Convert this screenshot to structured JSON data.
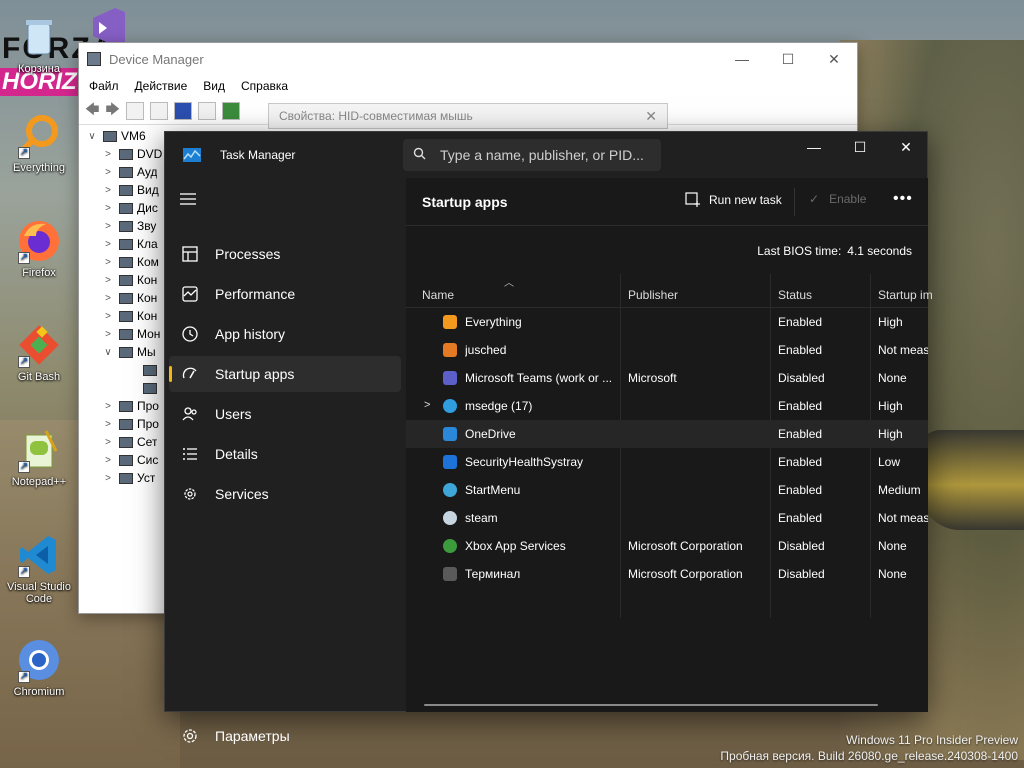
{
  "desktop": {
    "wallpaper_logo": {
      "line1": "FORZA",
      "line2": "HORIZ"
    },
    "icons": [
      {
        "name": "recycle-bin",
        "label": "Корзина"
      },
      {
        "name": "visual-studio",
        "label": ""
      },
      {
        "name": "everything",
        "label": "Everything"
      },
      {
        "name": "firefox",
        "label": "Firefox"
      },
      {
        "name": "git-bash",
        "label": "Git Bash"
      },
      {
        "name": "notepad-plus-plus",
        "label": "Notepad++"
      },
      {
        "name": "vscode",
        "label": "Visual Studio Code"
      },
      {
        "name": "chromium",
        "label": "Chromium"
      }
    ],
    "watermark": {
      "line1": "Windows 11 Pro Insider Preview",
      "line2": "Пробная версия. Build 26080.ge_release.240308-1400"
    }
  },
  "device_manager": {
    "title": "Device Manager",
    "menu": [
      "Файл",
      "Действие",
      "Вид",
      "Справка"
    ],
    "tree": [
      {
        "chev": "∨",
        "label": "VM6"
      },
      {
        "chev": ">",
        "label": "DVD"
      },
      {
        "chev": ">",
        "label": "Ауд"
      },
      {
        "chev": ">",
        "label": "Вид"
      },
      {
        "chev": ">",
        "label": "Дис"
      },
      {
        "chev": ">",
        "label": "Зву"
      },
      {
        "chev": ">",
        "label": "Кла"
      },
      {
        "chev": ">",
        "label": "Ком"
      },
      {
        "chev": ">",
        "label": "Кон"
      },
      {
        "chev": ">",
        "label": "Кон"
      },
      {
        "chev": ">",
        "label": "Кон"
      },
      {
        "chev": ">",
        "label": "Мон"
      },
      {
        "chev": "∨",
        "label": "Мы"
      },
      {
        "chev": "",
        "label": ""
      },
      {
        "chev": "",
        "label": ""
      },
      {
        "chev": ">",
        "label": "Про"
      },
      {
        "chev": ">",
        "label": "Про"
      },
      {
        "chev": ">",
        "label": "Сет"
      },
      {
        "chev": ">",
        "label": "Сис"
      },
      {
        "chev": ">",
        "label": "Уст"
      }
    ]
  },
  "properties_dialog": {
    "title": "Свойства: HID-совместимая мышь"
  },
  "task_manager": {
    "title": "Task Manager",
    "search_placeholder": "Type a name, publisher, or PID...",
    "nav": [
      {
        "label": "Processes",
        "icon": "processes-icon"
      },
      {
        "label": "Performance",
        "icon": "performance-icon"
      },
      {
        "label": "App history",
        "icon": "app-history-icon"
      },
      {
        "label": "Startup apps",
        "icon": "startup-apps-icon",
        "active": true
      },
      {
        "label": "Users",
        "icon": "users-icon"
      },
      {
        "label": "Details",
        "icon": "details-icon"
      },
      {
        "label": "Services",
        "icon": "services-icon"
      }
    ],
    "settings_label": "Параметры",
    "page_title": "Startup apps",
    "run_new_task": "Run new task",
    "enable": "Enable",
    "more": "•••",
    "bios_label": "Last BIOS time:",
    "bios_value": "4.1 seconds",
    "columns": [
      "Name",
      "Publisher",
      "Status",
      "Startup im"
    ],
    "rows": [
      {
        "name": "Everything",
        "publisher": "",
        "status": "Enabled",
        "impact": "High",
        "icon": "everything-icon",
        "color": "#f39a1e"
      },
      {
        "name": "jusched",
        "publisher": "",
        "status": "Enabled",
        "impact": "Not meas",
        "icon": "java-icon",
        "color": "#e57a24"
      },
      {
        "name": "Microsoft Teams (work or ...",
        "publisher": "Microsoft",
        "status": "Disabled",
        "impact": "None",
        "icon": "teams-icon",
        "color": "#5b5fc7"
      },
      {
        "name": "msedge (17)",
        "publisher": "",
        "status": "Enabled",
        "impact": "High",
        "icon": "edge-icon",
        "color": "#2f9de0",
        "expandable": true
      },
      {
        "name": "OneDrive",
        "publisher": "",
        "status": "Enabled",
        "impact": "High",
        "icon": "onedrive-icon",
        "color": "#2b88d8",
        "hover": true
      },
      {
        "name": "SecurityHealthSystray",
        "publisher": "",
        "status": "Enabled",
        "impact": "Low",
        "icon": "shield-icon",
        "color": "#1e73d8"
      },
      {
        "name": "StartMenu",
        "publisher": "",
        "status": "Enabled",
        "impact": "Medium",
        "icon": "startmenu-icon",
        "color": "#3ea6d8"
      },
      {
        "name": "steam",
        "publisher": "",
        "status": "Enabled",
        "impact": "Not meas",
        "icon": "steam-icon",
        "color": "#c7d5e0"
      },
      {
        "name": "Xbox App Services",
        "publisher": "Microsoft Corporation",
        "status": "Disabled",
        "impact": "None",
        "icon": "xbox-icon",
        "color": "#3c9b3c"
      },
      {
        "name": "Терминал",
        "publisher": "Microsoft Corporation",
        "status": "Disabled",
        "impact": "None",
        "icon": "terminal-icon",
        "color": "#5a5a5a"
      }
    ]
  }
}
